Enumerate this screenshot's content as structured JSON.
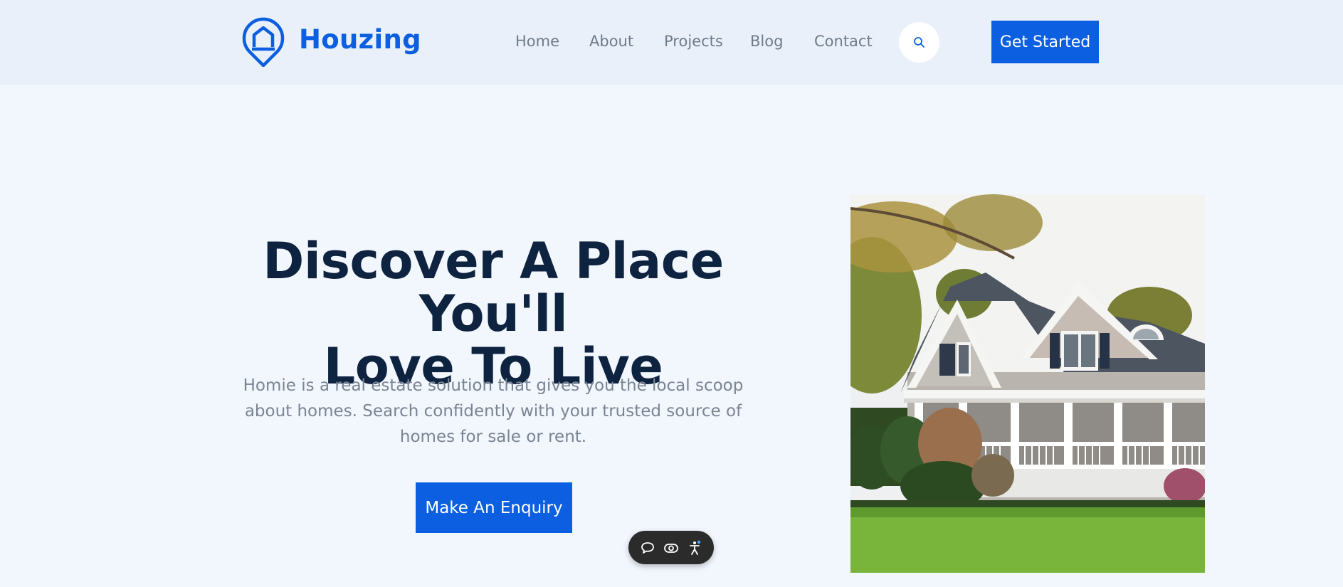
{
  "brand": {
    "name": "Houzing",
    "accent": "#0b5fe0"
  },
  "nav": {
    "items": [
      {
        "label": "Home"
      },
      {
        "label": "About"
      },
      {
        "label": "Projects"
      },
      {
        "label": "Blog"
      },
      {
        "label": "Contact"
      }
    ],
    "search_icon": "search-icon",
    "cta_label": "Get Started"
  },
  "hero": {
    "title_line1": "Discover A Place You'll",
    "title_line2": "Love To Live",
    "description": "Homie is a real estate solution that gives you the local scoop about homes. Search confidently with your trusted source of homes for sale or rent.",
    "button_label": "Make An Enquiry"
  },
  "widget": {
    "icons": [
      "chat-bubble-icon",
      "eye-icon",
      "accessibility-icon"
    ]
  },
  "colors": {
    "header_bg": "#e9f0fa",
    "page_bg": "#f2f6fd",
    "title": "#0e2340",
    "muted_text": "#7a8593"
  }
}
